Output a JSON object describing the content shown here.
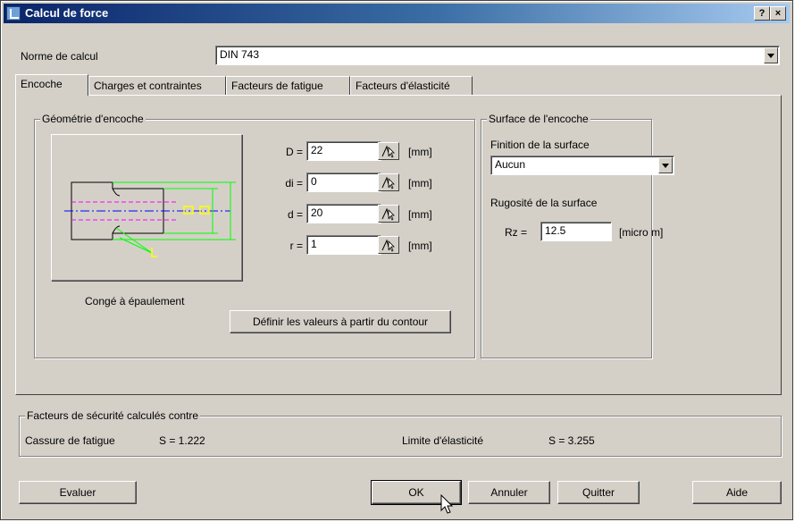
{
  "window": {
    "title": "Calcul de force",
    "help_btn": "?",
    "close_btn": "×"
  },
  "norme": {
    "label": "Norme de calcul",
    "value": "DIN 743"
  },
  "tabs": [
    {
      "label": "Encoche"
    },
    {
      "label": "Charges et contraintes"
    },
    {
      "label": "Facteurs de fatigue"
    },
    {
      "label": "Facteurs d'élasticité"
    }
  ],
  "geometry": {
    "title": "Géométrie d'encoche",
    "caption": "Congé à épaulement",
    "fields": [
      {
        "label": "D =",
        "value": "22",
        "unit": "[mm]"
      },
      {
        "label": "di =",
        "value": "0",
        "unit": "[mm]"
      },
      {
        "label": "d =",
        "value": "20",
        "unit": "[mm]"
      },
      {
        "label": "r =",
        "value": "1",
        "unit": "[mm]"
      }
    ],
    "define_btn": "Définir les valeurs à partir du contour"
  },
  "surface": {
    "title": "Surface de l'encoche",
    "finish_label": "Finition de la surface",
    "finish_value": "Aucun",
    "rough_label": "Rugosité de la surface",
    "rz_label": "Rz =",
    "rz_value": "12.5",
    "rz_unit": "[micro m]"
  },
  "safety": {
    "title": "Facteurs de sécurité calculés contre",
    "fatigue_label": "Cassure de fatigue",
    "fatigue_value": "S =  1.222",
    "yield_label": "Limite d'élasticité",
    "yield_value": "S =  3.255"
  },
  "buttons": {
    "evaluate": "Evaluer",
    "ok": "OK",
    "cancel": "Annuler",
    "quit": "Quitter",
    "help": "Aide"
  },
  "colors": {
    "titlebar": "#0a246a",
    "dialog_bg": "#d4d0c8",
    "dim_green": "#00ff00",
    "axis_blue": "#0000ff",
    "hidden_magenta": "#ff00ff"
  }
}
